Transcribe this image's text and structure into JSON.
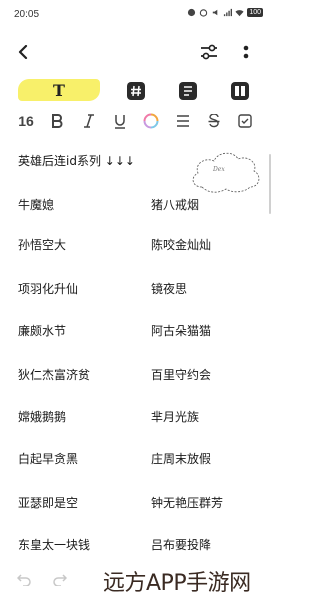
{
  "status_bar": {
    "time": "20:05",
    "battery": "100"
  },
  "toolbar": {
    "text_style_label": "T",
    "font_size": "16"
  },
  "note": {
    "heading": "英雄后连id系列 ↓↓↓",
    "handwriting_text": "Dex",
    "pairs": [
      [
        "牛魔媳",
        "猪八戒烟"
      ],
      [
        "孙悟空大",
        "陈咬金灿灿"
      ],
      [
        "项羽化升仙",
        "镜夜思"
      ],
      [
        "廉颇水节",
        "阿古朵猫猫"
      ],
      [
        "狄仁杰富济贫",
        "百里守约会"
      ],
      [
        "嫦娥鹅鹅",
        "芈月光族"
      ],
      [
        "白起早贪黑",
        "庄周末放假"
      ],
      [
        "亚瑟即是空",
        "钟无艳压群芳"
      ],
      [
        "东皇太一块钱",
        "吕布要投降"
      ]
    ]
  },
  "watermark": "远方APP手游网"
}
